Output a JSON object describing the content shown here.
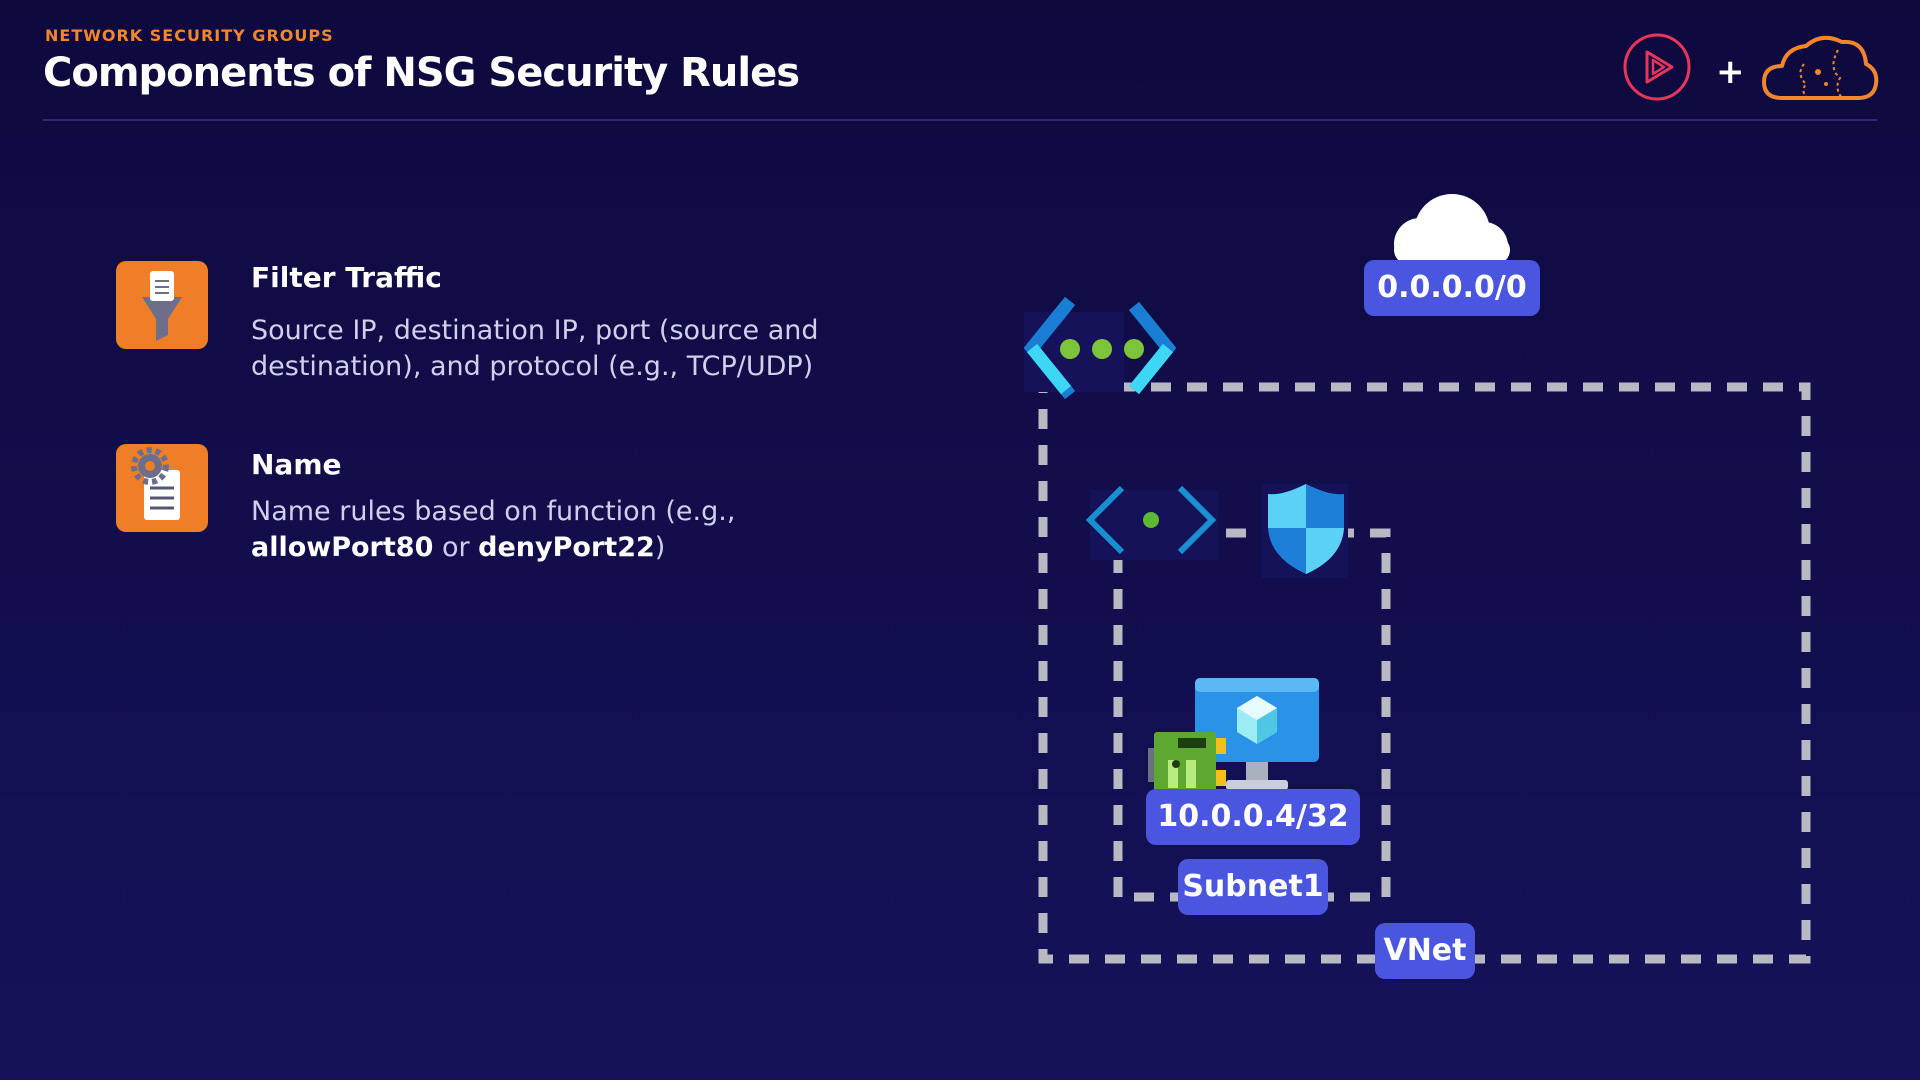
{
  "header": {
    "eyebrow": "NETWORK SECURITY GROUPS",
    "title": "Components of NSG Security Rules",
    "plus": "+"
  },
  "features": [
    {
      "title": "Filter Traffic",
      "description": "Source IP, destination IP, port (source and destination), and protocol (e.g., TCP/UDP)",
      "icon": "funnel-document-icon"
    },
    {
      "title": "Name",
      "description_prefix": "Name rules based on function (e.g.,",
      "example_1": "allowPort80",
      "connector": "or",
      "example_2": "denyPort22",
      "description_suffix": ")",
      "icon": "gear-document-icon"
    }
  ],
  "diagram": {
    "internet_label": "0.0.0.0/0",
    "vm_label": "10.0.0.4/32",
    "subnet_label": "Subnet1",
    "vnet_label": "VNet",
    "icons": [
      "cloud-icon",
      "virtual-network-icon",
      "subnet-icon",
      "shield-icon",
      "virtual-machine-icon",
      "network-interface-icon"
    ]
  },
  "colors": {
    "background": "#120e4c",
    "accent_orange": "#ef7e26",
    "label_blue": "#4a56e0",
    "dashed_gray": "#b9b9c4"
  }
}
